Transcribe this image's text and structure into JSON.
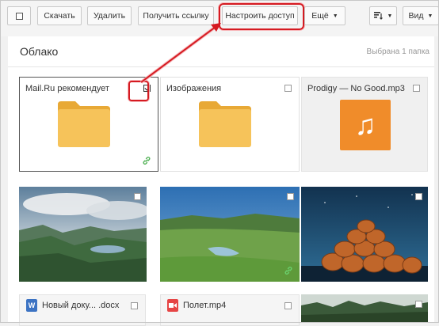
{
  "toolbar": {
    "download": "Скачать",
    "delete": "Удалить",
    "get_link": "Получить ссылку",
    "share": "Настроить доступ",
    "more": "Ещё",
    "view": "Вид"
  },
  "header": {
    "title": "Облако",
    "status": "Выбрана 1 папка"
  },
  "tiles": [
    {
      "name": "Mail.Ru рекомендует",
      "type": "folder",
      "checked": true
    },
    {
      "name": "Изображения",
      "type": "folder",
      "checked": false
    },
    {
      "name": "Prodigy — No Good.mp3",
      "type": "audio",
      "checked": false
    }
  ],
  "bottom_files": [
    {
      "name": "Новый доку... .docx",
      "icon": "W"
    },
    {
      "name": "Полет.mp4",
      "icon": "video"
    }
  ],
  "colors": {
    "folder": "#f6c35a",
    "folder_tab": "#e8a936",
    "highlight": "#d51a21",
    "audio": "#f08c2a",
    "word": "#3c73c3",
    "video": "#e64545"
  }
}
